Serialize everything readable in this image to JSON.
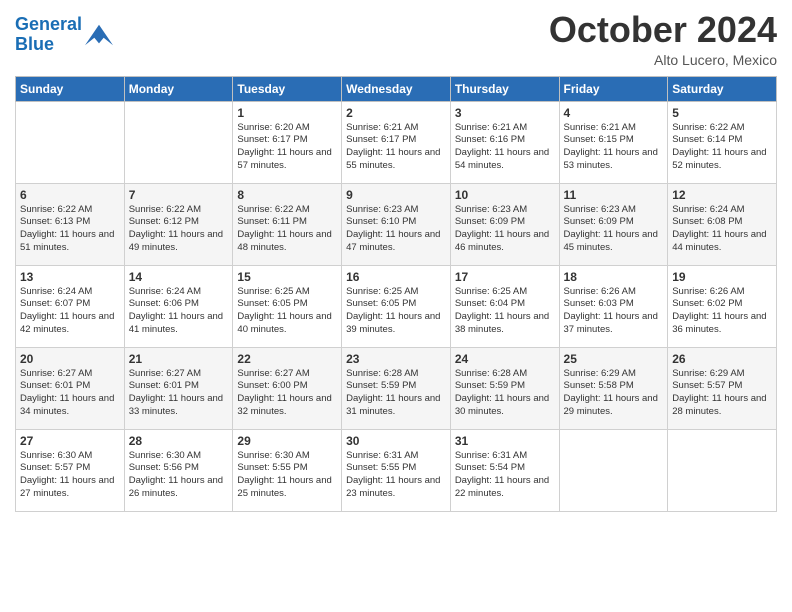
{
  "logo": {
    "line1": "General",
    "line2": "Blue"
  },
  "title": "October 2024",
  "location": "Alto Lucero, Mexico",
  "days_of_week": [
    "Sunday",
    "Monday",
    "Tuesday",
    "Wednesday",
    "Thursday",
    "Friday",
    "Saturday"
  ],
  "weeks": [
    [
      {
        "day": "",
        "info": ""
      },
      {
        "day": "",
        "info": ""
      },
      {
        "day": "1",
        "info": "Sunrise: 6:20 AM\nSunset: 6:17 PM\nDaylight: 11 hours and 57 minutes."
      },
      {
        "day": "2",
        "info": "Sunrise: 6:21 AM\nSunset: 6:17 PM\nDaylight: 11 hours and 55 minutes."
      },
      {
        "day": "3",
        "info": "Sunrise: 6:21 AM\nSunset: 6:16 PM\nDaylight: 11 hours and 54 minutes."
      },
      {
        "day": "4",
        "info": "Sunrise: 6:21 AM\nSunset: 6:15 PM\nDaylight: 11 hours and 53 minutes."
      },
      {
        "day": "5",
        "info": "Sunrise: 6:22 AM\nSunset: 6:14 PM\nDaylight: 11 hours and 52 minutes."
      }
    ],
    [
      {
        "day": "6",
        "info": "Sunrise: 6:22 AM\nSunset: 6:13 PM\nDaylight: 11 hours and 51 minutes."
      },
      {
        "day": "7",
        "info": "Sunrise: 6:22 AM\nSunset: 6:12 PM\nDaylight: 11 hours and 49 minutes."
      },
      {
        "day": "8",
        "info": "Sunrise: 6:22 AM\nSunset: 6:11 PM\nDaylight: 11 hours and 48 minutes."
      },
      {
        "day": "9",
        "info": "Sunrise: 6:23 AM\nSunset: 6:10 PM\nDaylight: 11 hours and 47 minutes."
      },
      {
        "day": "10",
        "info": "Sunrise: 6:23 AM\nSunset: 6:09 PM\nDaylight: 11 hours and 46 minutes."
      },
      {
        "day": "11",
        "info": "Sunrise: 6:23 AM\nSunset: 6:09 PM\nDaylight: 11 hours and 45 minutes."
      },
      {
        "day": "12",
        "info": "Sunrise: 6:24 AM\nSunset: 6:08 PM\nDaylight: 11 hours and 44 minutes."
      }
    ],
    [
      {
        "day": "13",
        "info": "Sunrise: 6:24 AM\nSunset: 6:07 PM\nDaylight: 11 hours and 42 minutes."
      },
      {
        "day": "14",
        "info": "Sunrise: 6:24 AM\nSunset: 6:06 PM\nDaylight: 11 hours and 41 minutes."
      },
      {
        "day": "15",
        "info": "Sunrise: 6:25 AM\nSunset: 6:05 PM\nDaylight: 11 hours and 40 minutes."
      },
      {
        "day": "16",
        "info": "Sunrise: 6:25 AM\nSunset: 6:05 PM\nDaylight: 11 hours and 39 minutes."
      },
      {
        "day": "17",
        "info": "Sunrise: 6:25 AM\nSunset: 6:04 PM\nDaylight: 11 hours and 38 minutes."
      },
      {
        "day": "18",
        "info": "Sunrise: 6:26 AM\nSunset: 6:03 PM\nDaylight: 11 hours and 37 minutes."
      },
      {
        "day": "19",
        "info": "Sunrise: 6:26 AM\nSunset: 6:02 PM\nDaylight: 11 hours and 36 minutes."
      }
    ],
    [
      {
        "day": "20",
        "info": "Sunrise: 6:27 AM\nSunset: 6:01 PM\nDaylight: 11 hours and 34 minutes."
      },
      {
        "day": "21",
        "info": "Sunrise: 6:27 AM\nSunset: 6:01 PM\nDaylight: 11 hours and 33 minutes."
      },
      {
        "day": "22",
        "info": "Sunrise: 6:27 AM\nSunset: 6:00 PM\nDaylight: 11 hours and 32 minutes."
      },
      {
        "day": "23",
        "info": "Sunrise: 6:28 AM\nSunset: 5:59 PM\nDaylight: 11 hours and 31 minutes."
      },
      {
        "day": "24",
        "info": "Sunrise: 6:28 AM\nSunset: 5:59 PM\nDaylight: 11 hours and 30 minutes."
      },
      {
        "day": "25",
        "info": "Sunrise: 6:29 AM\nSunset: 5:58 PM\nDaylight: 11 hours and 29 minutes."
      },
      {
        "day": "26",
        "info": "Sunrise: 6:29 AM\nSunset: 5:57 PM\nDaylight: 11 hours and 28 minutes."
      }
    ],
    [
      {
        "day": "27",
        "info": "Sunrise: 6:30 AM\nSunset: 5:57 PM\nDaylight: 11 hours and 27 minutes."
      },
      {
        "day": "28",
        "info": "Sunrise: 6:30 AM\nSunset: 5:56 PM\nDaylight: 11 hours and 26 minutes."
      },
      {
        "day": "29",
        "info": "Sunrise: 6:30 AM\nSunset: 5:55 PM\nDaylight: 11 hours and 25 minutes."
      },
      {
        "day": "30",
        "info": "Sunrise: 6:31 AM\nSunset: 5:55 PM\nDaylight: 11 hours and 23 minutes."
      },
      {
        "day": "31",
        "info": "Sunrise: 6:31 AM\nSunset: 5:54 PM\nDaylight: 11 hours and 22 minutes."
      },
      {
        "day": "",
        "info": ""
      },
      {
        "day": "",
        "info": ""
      }
    ]
  ]
}
